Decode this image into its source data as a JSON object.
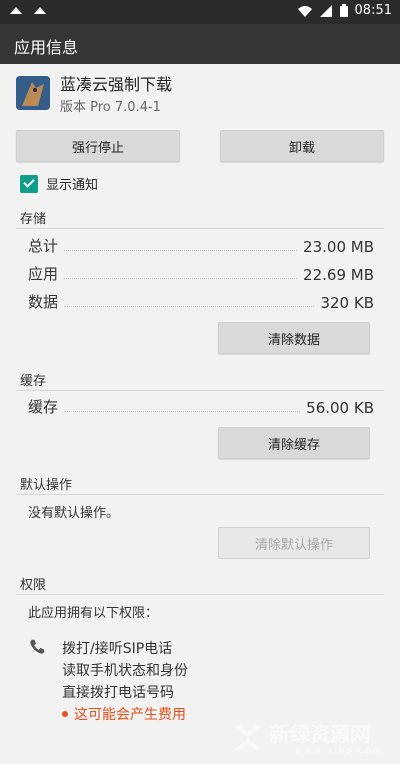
{
  "statusbar": {
    "time": "08:51"
  },
  "appbar": {
    "title": "应用信息"
  },
  "app": {
    "name": "蓝凑云强制下载",
    "version": "版本 Pro 7.0.4-1"
  },
  "buttons": {
    "force_stop": "强行停止",
    "uninstall": "卸载",
    "clear_data": "清除数据",
    "clear_cache": "清除缓存",
    "clear_defaults": "清除默认操作"
  },
  "notifications": {
    "label": "显示通知",
    "checked": true
  },
  "storage": {
    "title": "存储",
    "rows": [
      {
        "label": "总计",
        "value": "23.00 MB"
      },
      {
        "label": "应用",
        "value": "22.69 MB"
      },
      {
        "label": "数据",
        "value": "320 KB"
      }
    ]
  },
  "cache": {
    "title": "缓存",
    "rows": [
      {
        "label": "缓存",
        "value": "56.00 KB"
      }
    ]
  },
  "defaults": {
    "title": "默认操作",
    "note": "没有默认操作。"
  },
  "permissions": {
    "title": "权限",
    "intro": "此应用拥有以下权限：",
    "items": [
      "拨打/接听SIP电话",
      "读取手机状态和身份",
      "直接拨打电话号码"
    ],
    "warning": "这可能会产生费用"
  },
  "watermark": {
    "text": "新绿资源网",
    "sub": "www.xlhs.com"
  }
}
